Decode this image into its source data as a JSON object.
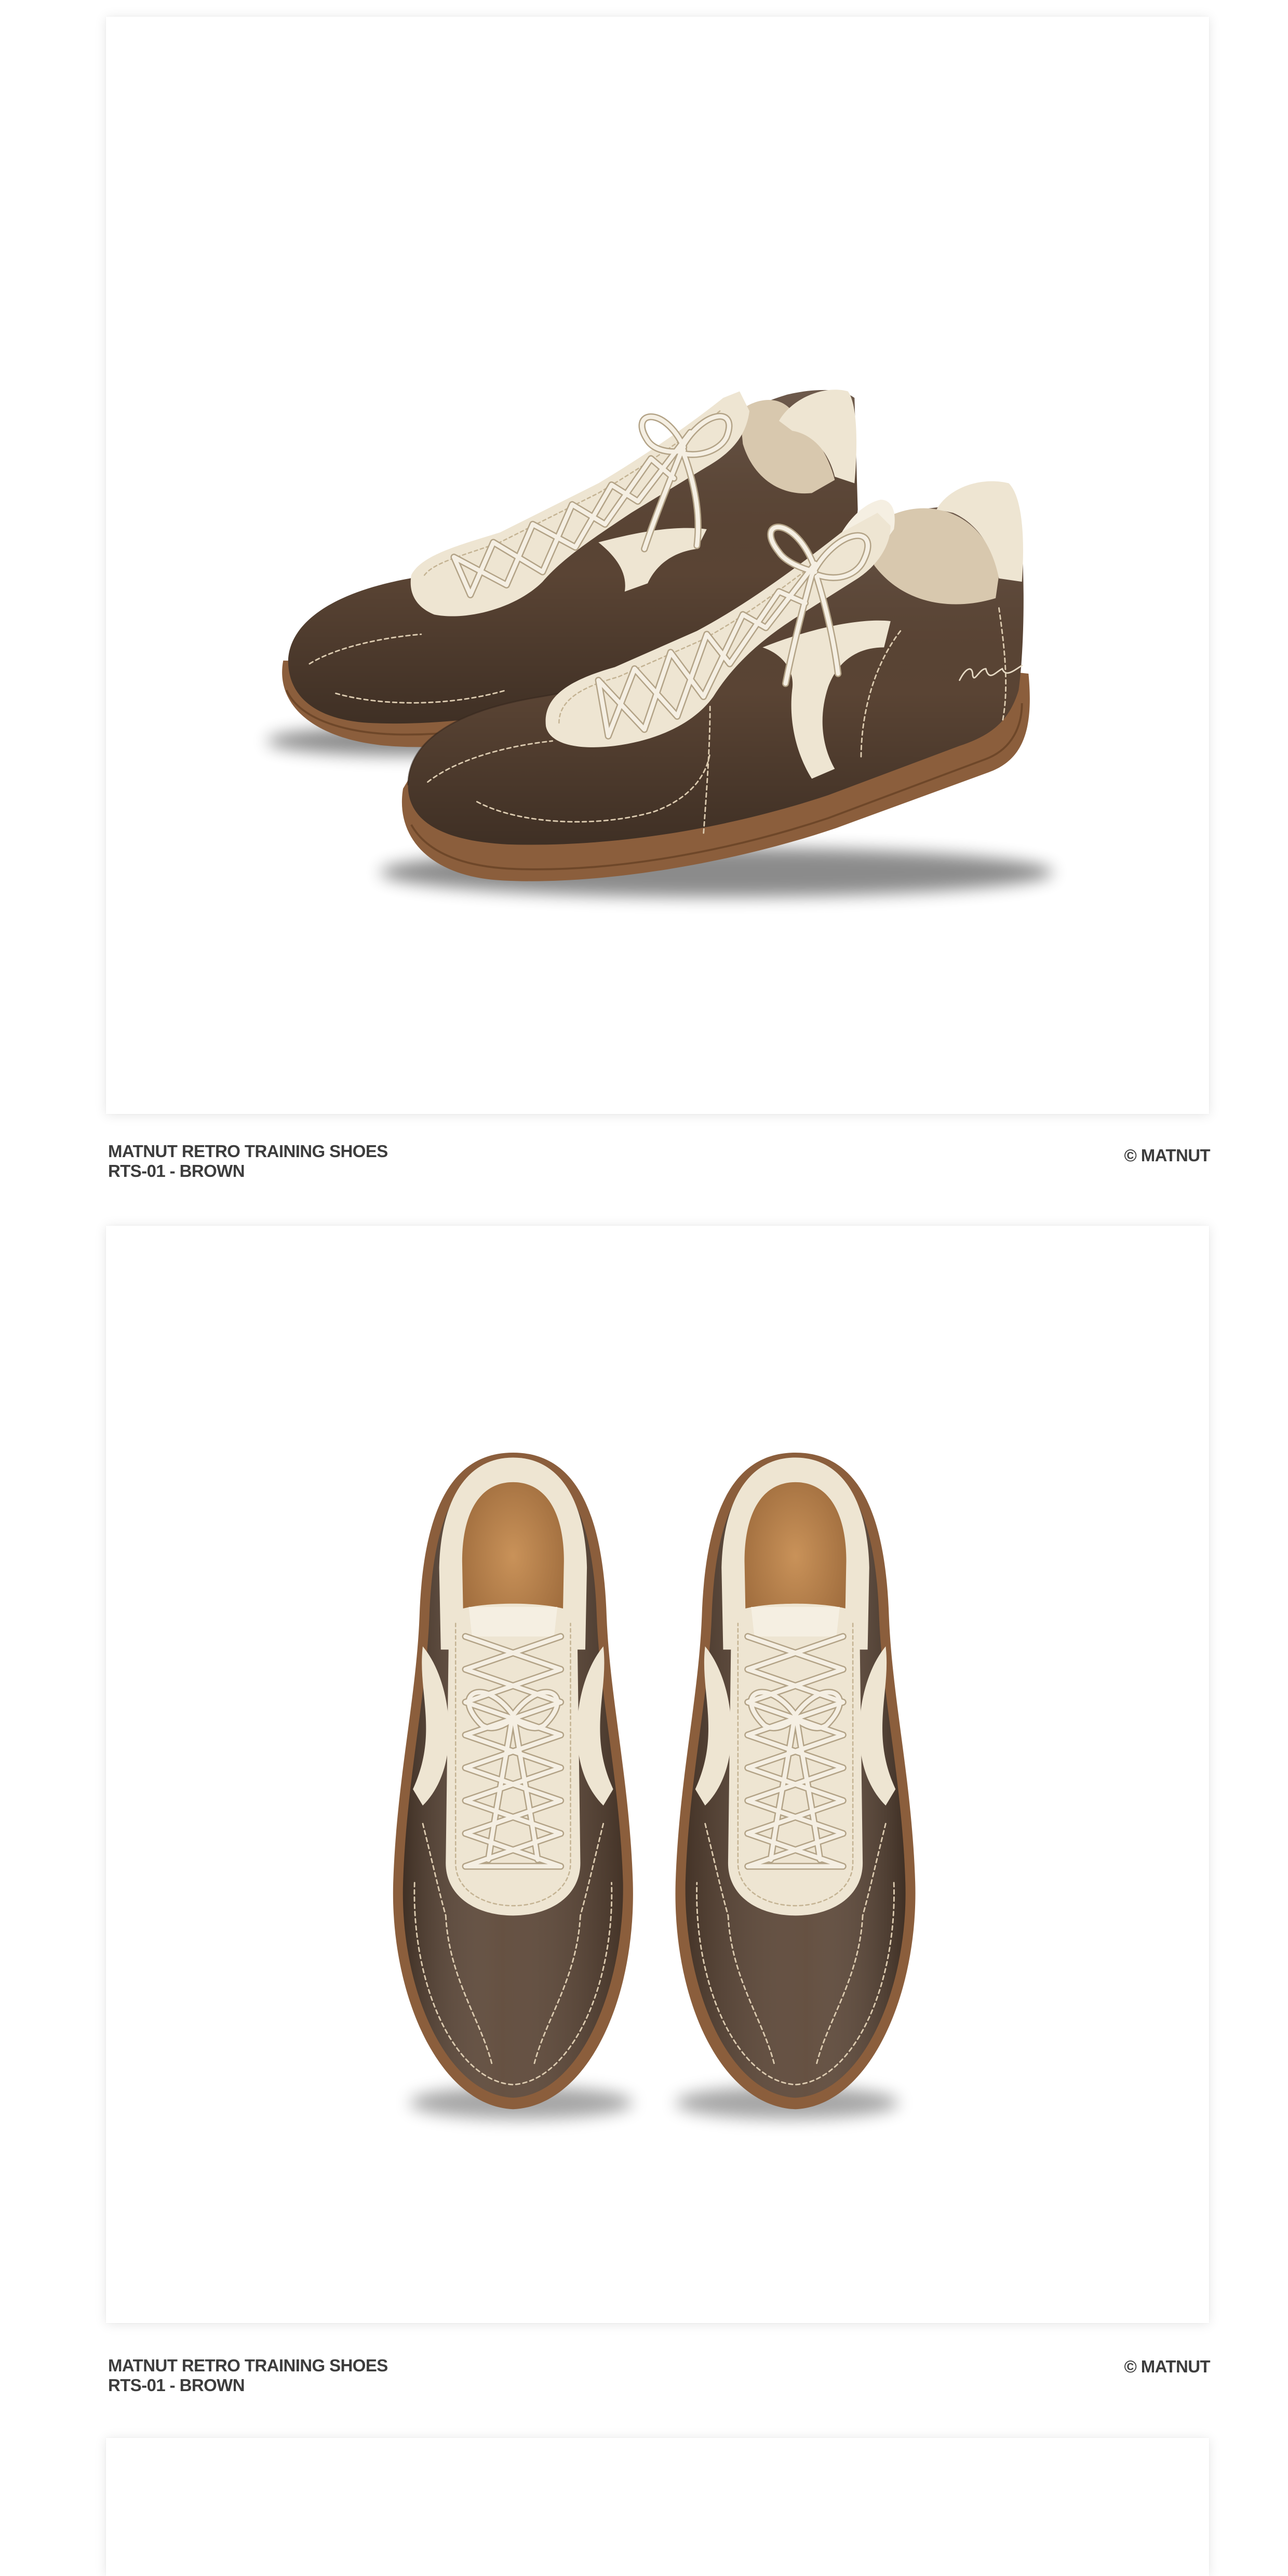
{
  "gallery": [
    {
      "caption": {
        "title": "MATNUT RETRO TRAINING SHOES",
        "subtitle": "RTS-01 - BROWN",
        "credit": "© MATNUT"
      }
    },
    {
      "caption": {
        "title": "MATNUT RETRO TRAINING SHOES",
        "subtitle": "RTS-01 - BROWN",
        "credit": "© MATNUT"
      }
    }
  ],
  "colors": {
    "background": "#ffffff",
    "caption_text": "#3d3d3d",
    "leather_brown": "#5a4434",
    "cream_suede": "#eee5d2",
    "gum_sole": "#8b5e3c",
    "cork_insole": "#b9824c"
  }
}
